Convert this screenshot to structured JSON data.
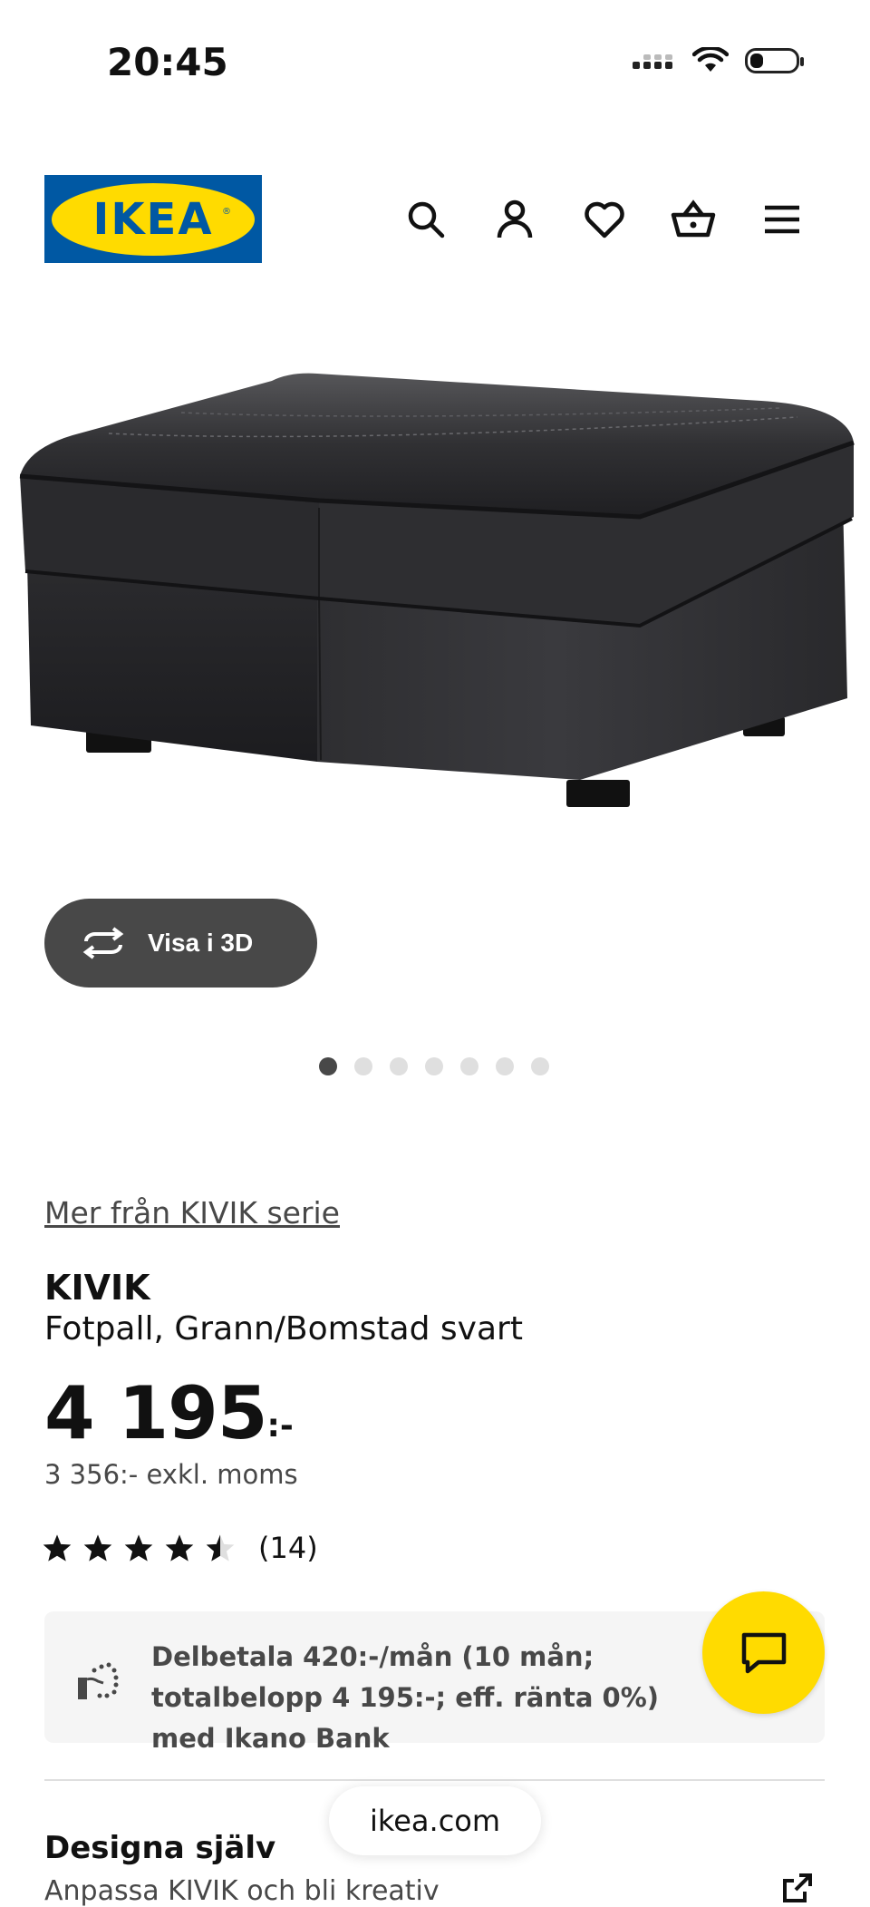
{
  "status_bar": {
    "time": "20:45",
    "signal_icon": "cellular-signal-icon",
    "wifi_icon": "wifi-icon",
    "battery_icon": "battery-icon",
    "battery_level": 0.3
  },
  "header": {
    "logo_text": "IKEA",
    "logo_colors": {
      "background": "#0058a3",
      "oval": "#ffdb00"
    },
    "icons": [
      "search-icon",
      "account-icon",
      "heart-icon",
      "basket-icon",
      "menu-icon"
    ]
  },
  "gallery": {
    "view_3d_label": "Visa i 3D",
    "view_3d_icon": "rotate-arrows-icon",
    "dot_count": 7,
    "active_dot": 0
  },
  "product": {
    "series_link": "Mer från KIVIK serie",
    "name": "KIVIK",
    "description": "Fotpall, Grann/Bomstad svart",
    "price": "4 195",
    "price_suffix": ":-",
    "price_excl_vat": "3 356:- exkl. moms",
    "rating_stars": 4.5,
    "rating_max": 5,
    "review_count": "(14)"
  },
  "installment": {
    "icon": "payment-hand-icon",
    "text": "Delbetala 420:-/mån (10 mån; totalbelopp 4 195:-; eff. ränta 0%) med Ikano Bank"
  },
  "chat": {
    "icon": "chat-bubble-icon",
    "color": "#ffdb00"
  },
  "design_section": {
    "title": "Designa själv",
    "subtitle": "Anpassa KIVIK och bli kreativ",
    "external_icon": "external-link-icon"
  },
  "browser": {
    "url": "ikea.com"
  }
}
